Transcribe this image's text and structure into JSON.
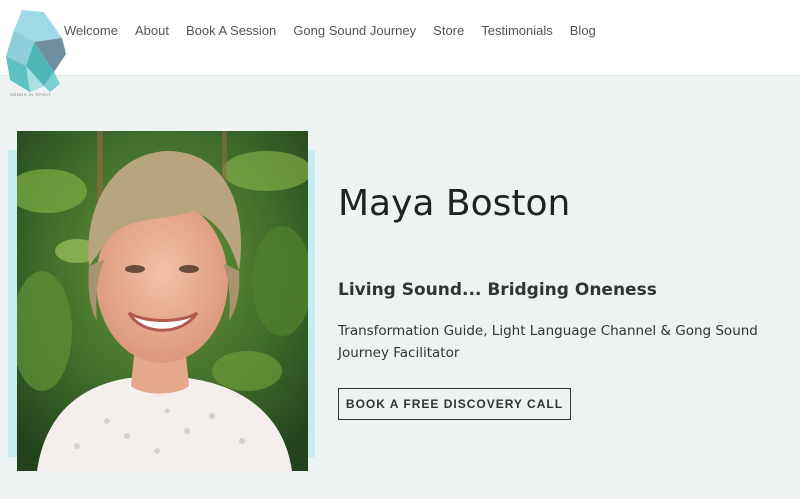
{
  "logo": {
    "text": "SONGS IN SPIRIT",
    "icon": "crystal-logo-icon"
  },
  "nav": {
    "items": [
      {
        "label": "Welcome"
      },
      {
        "label": "About"
      },
      {
        "label": "Book A Session"
      },
      {
        "label": "Gong Sound Journey"
      },
      {
        "label": "Store"
      },
      {
        "label": "Testimonials"
      },
      {
        "label": "Blog"
      }
    ]
  },
  "hero": {
    "name": "Maya Boston",
    "tagline": "Living Sound... Bridging Oneness",
    "description": "Transformation Guide, Light Language Channel & Gong Sound Journey Facilitator",
    "cta_label": "BOOK A FREE DISCOVERY CALL"
  },
  "colors": {
    "background": "#edf2f2",
    "header": "#ffffff",
    "accent": "#c7ecef",
    "logo_teal": "#5bbcbf",
    "text_dark": "#222222"
  }
}
